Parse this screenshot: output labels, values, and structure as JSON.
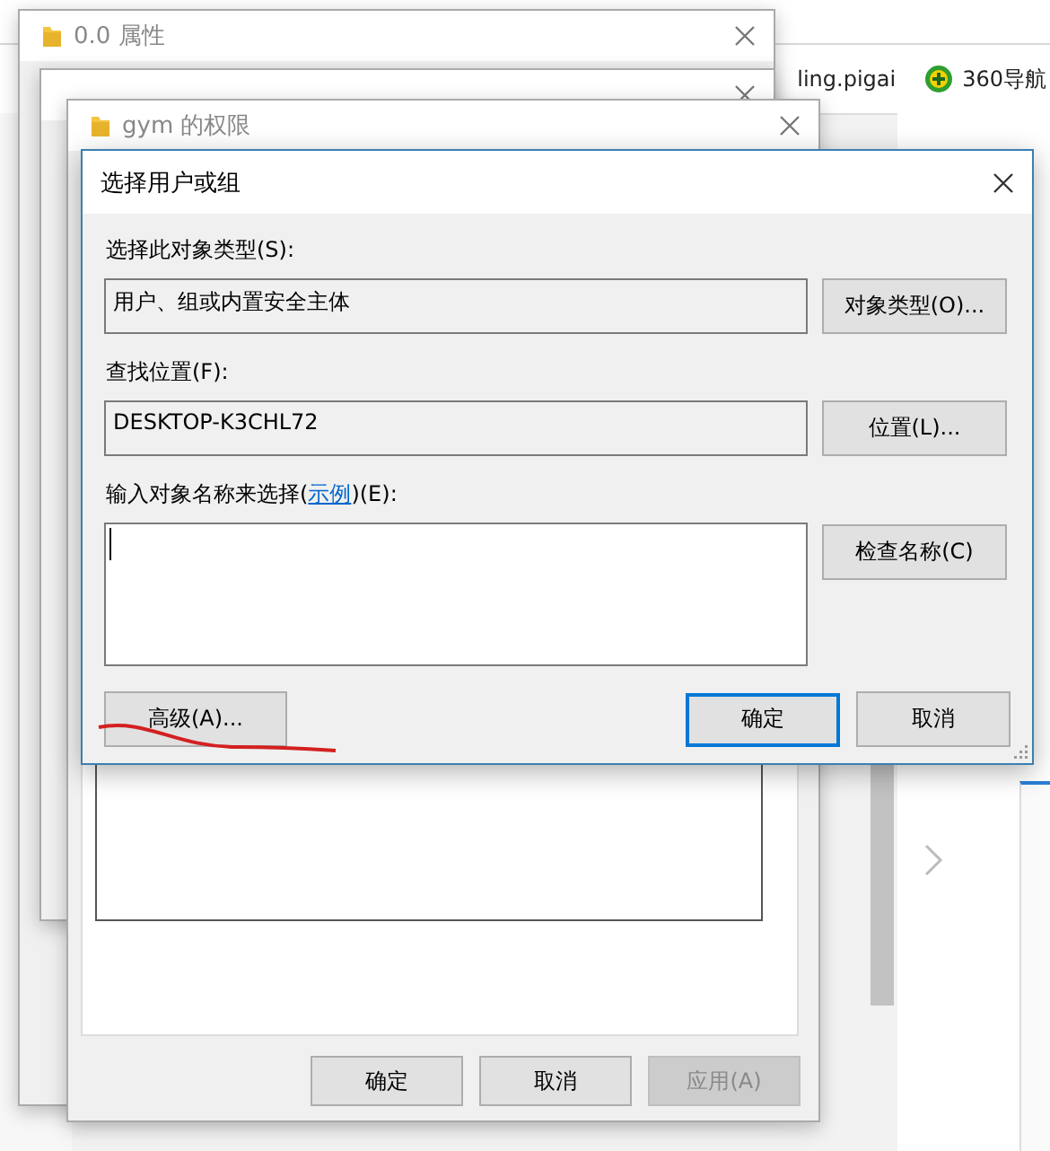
{
  "browser": {
    "bookmarks": [
      {
        "kind": "page",
        "label": "ling.pigai"
      },
      {
        "kind": "nav360",
        "label": "360导航"
      }
    ]
  },
  "background_windows": [
    {
      "kind": "properties",
      "title": "0.0 属性"
    },
    {
      "kind": "sharing"
    },
    {
      "kind": "permissions",
      "title": "gym 的权限",
      "buttons": [
        {
          "label": "确定",
          "disabled": false
        },
        {
          "label": "取消",
          "disabled": false
        },
        {
          "label": "应用(A)",
          "disabled": true
        }
      ]
    }
  ],
  "dialog": {
    "title": "选择用户或组",
    "object_type": {
      "label": "选择此对象类型(S):",
      "value": "用户、组或内置安全主体",
      "button": "对象类型(O)..."
    },
    "location": {
      "label": "查找位置(F):",
      "value": "DESKTOP-K3CHL72",
      "button": "位置(L)..."
    },
    "names": {
      "label_before": "输入对象名称来选择(",
      "link": "示例",
      "label_after": ")(E):",
      "button": "检查名称(C)"
    },
    "advanced_button": "高级(A)...",
    "ok_button": {
      "label": "确定",
      "default": true
    },
    "cancel_button": "取消"
  }
}
